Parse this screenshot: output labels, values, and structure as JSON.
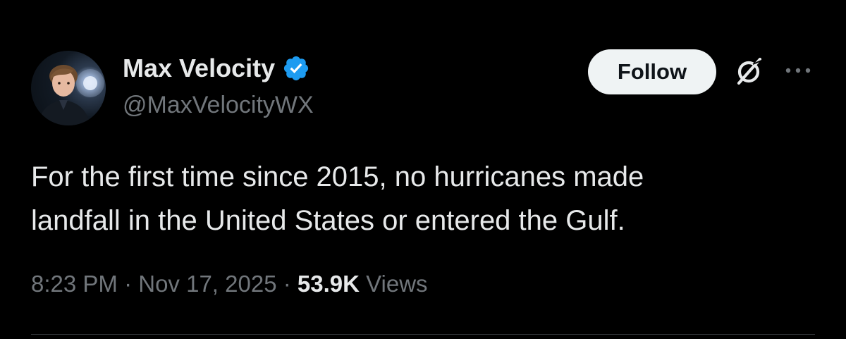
{
  "author": {
    "display_name": "Max Velocity",
    "handle": "@MaxVelocityWX",
    "verified": true,
    "avatar_icon": "avatar-photo"
  },
  "actions": {
    "follow_label": "Follow",
    "grok_icon": "grok-icon",
    "more_icon": "more-options-icon"
  },
  "tweet": {
    "text": "For the first time since 2015, no hurricanes made\nlandfall in the United States or entered the Gulf.",
    "time": "8:23 PM",
    "separator": " · ",
    "date": "Nov 17, 2025",
    "views_count": "53.9K",
    "views_label": "Views"
  },
  "colors": {
    "background": "#000000",
    "primary_text": "#e7e9ea",
    "secondary_text": "#71767b",
    "verified_badge": "#1d9bf0",
    "follow_button_bg": "#eff3f4",
    "follow_button_text": "#0f1419",
    "divider": "#2f3336"
  }
}
